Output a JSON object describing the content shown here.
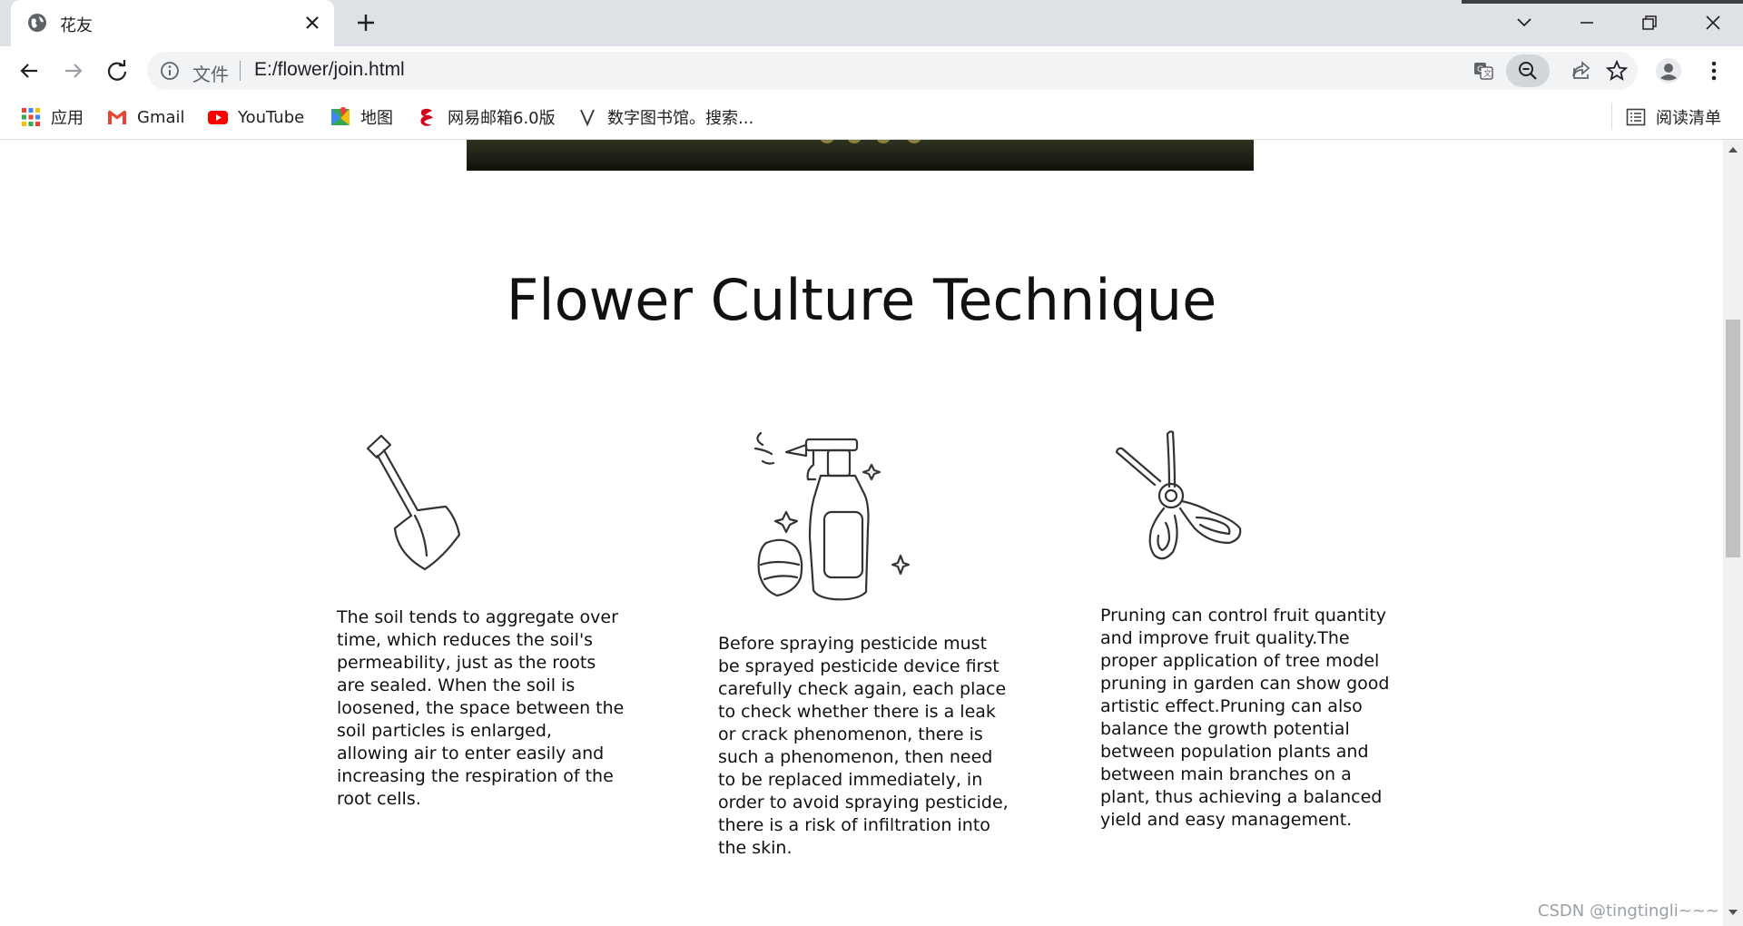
{
  "tab": {
    "title": "花友"
  },
  "omnibox": {
    "scheme_label": "文件",
    "url": "E:/flower/join.html"
  },
  "bookmarks": {
    "items": [
      {
        "label": "应用",
        "icon": "apps-grid-icon"
      },
      {
        "label": "Gmail",
        "icon": "gmail-icon"
      },
      {
        "label": "YouTube",
        "icon": "youtube-icon"
      },
      {
        "label": "地图",
        "icon": "maps-icon"
      },
      {
        "label": "网易邮箱6.0版",
        "icon": "netease-mail-icon"
      },
      {
        "label": "数字图书馆。搜索...",
        "icon": "library-v-icon"
      }
    ],
    "reading_list": "阅读清单"
  },
  "page": {
    "title": "Flower Culture Technique",
    "cards": [
      {
        "icon": "shovel-icon",
        "text": "The soil tends to aggregate over time, which reduces the soil's permeability, just as the roots are sealed. When the soil is loosened, the space between the soil particles is enlarged, allowing air to enter easily and increasing the respiration of the root cells."
      },
      {
        "icon": "spray-bottle-icon",
        "text": "Before spraying pesticide must be sprayed pesticide device first carefully check again, each place to check whether there is a leak or crack phenomenon, there is such a phenomenon, then need to be replaced immediately, in order to avoid spraying pesticide, there is a risk of infiltration into the skin."
      },
      {
        "icon": "scissors-icon",
        "text": "Pruning can control fruit quantity and improve fruit quality.The proper application of tree model pruning in garden can show good artistic effect.Pruning can also balance the growth potential between population plants and between main branches on a plant, thus achieving a balanced yield and easy management."
      }
    ]
  },
  "watermark": "CSDN @tingtingli~~~"
}
